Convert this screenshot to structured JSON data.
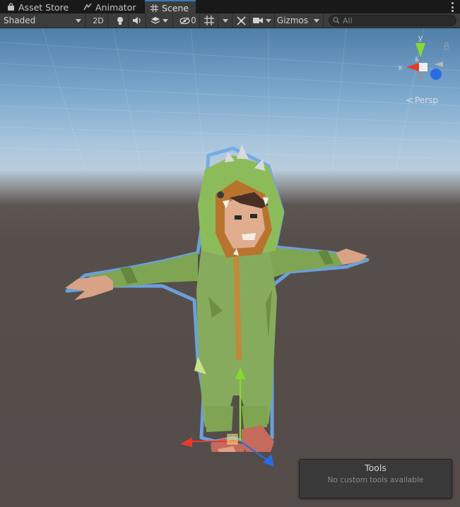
{
  "tabs": [
    {
      "label": "Asset Store",
      "icon": "shopping-bag-icon",
      "active": false
    },
    {
      "label": "Animator",
      "icon": "animator-icon",
      "active": false
    },
    {
      "label": "Scene",
      "icon": "grid-hash-icon",
      "active": true
    }
  ],
  "toolbar": {
    "draw_mode": "Shaded",
    "mode_2d": "2D",
    "lighting_icon": "lightbulb-icon",
    "audio_icon": "speaker-icon",
    "effects_icon": "layers-icon",
    "hidden_count": "0",
    "grid_icon": "grid-icon",
    "tools_icon": "cross-tools-icon",
    "camera_icon": "camera-icon",
    "gizmos_label": "Gizmos",
    "search_placeholder": "All"
  },
  "scene_gizmo": {
    "y_label": "y",
    "x_label": "x",
    "projection": "Persp",
    "colors": {
      "x": "#e53a2b",
      "y": "#85d92e",
      "z": "#2a6be5"
    }
  },
  "tools_overlay": {
    "title": "Tools",
    "message": "No custom tools available"
  }
}
